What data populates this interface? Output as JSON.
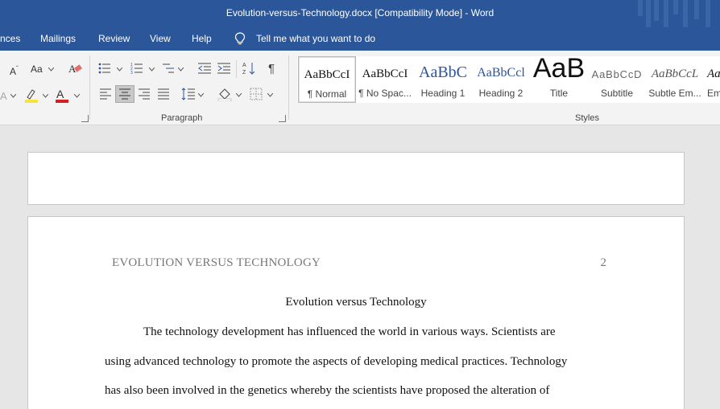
{
  "window": {
    "title": "Evolution-versus-Technology.docx  [Compatibility Mode]  -  Word"
  },
  "menu": {
    "items": [
      "nces",
      "Mailings",
      "Review",
      "View",
      "Help"
    ],
    "tell_me": "Tell me what you want to do"
  },
  "ribbon": {
    "font_size_btn": "A",
    "change_case_btn": "Aa",
    "paragraph_label": "Paragraph",
    "styles_label": "Styles",
    "styles": [
      {
        "sample": "AaBbCcI",
        "name": "¶ Normal"
      },
      {
        "sample": "AaBbCcI",
        "name": "¶ No Spac..."
      },
      {
        "sample": "AaBbC",
        "name": "Heading 1"
      },
      {
        "sample": "AaBbCcl",
        "name": "Heading 2"
      },
      {
        "sample": "AaB",
        "name": "Title"
      },
      {
        "sample": "AaBbCcD",
        "name": "Subtitle"
      },
      {
        "sample": "AaBbCcL",
        "name": "Subtle Em..."
      },
      {
        "sample": "Aa",
        "name": "Em"
      }
    ]
  },
  "colors": {
    "brand": "#2b579a",
    "highlight": "#f7e43a",
    "font_color": "#d21f1f",
    "heading_blue": "#2e5496"
  },
  "document": {
    "running_head": "EVOLUTION VERSUS TECHNOLOGY",
    "page_number": "2",
    "title": "Evolution versus Technology",
    "lines": [
      "The technology development has influenced the world in various ways. Scientists are",
      "using advanced technology to promote the aspects of developing medical practices. Technology",
      "has also been involved in the genetics whereby the scientists have proposed the alteration of"
    ]
  }
}
